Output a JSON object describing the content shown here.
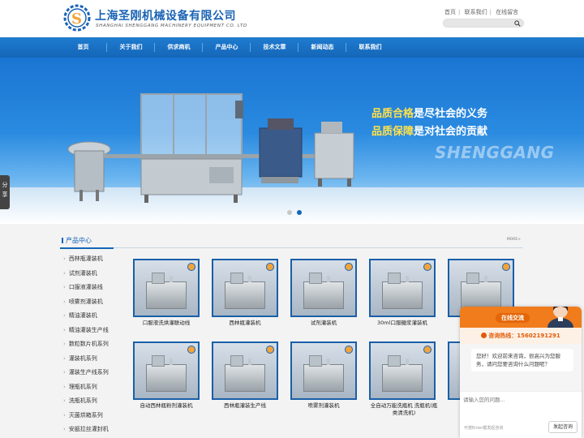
{
  "header": {
    "company_cn": "上海圣刚机械设备有限公司",
    "company_en": "SHANGHAI SHENGGANG MACHINERY EQUIPMENT CO. LTD",
    "links": [
      "首页",
      "联系我们",
      "在线留言"
    ],
    "search_placeholder": ""
  },
  "nav": [
    "首页",
    "关于我们",
    "供求商机",
    "产品中心",
    "技术文章",
    "新闻动态",
    "联系我们"
  ],
  "banner": {
    "slogan1_hl": "品质合格",
    "slogan1_rest": "是尽社会的义务",
    "slogan2_hl": "品质保障",
    "slogan2_rest": "是对社会的贡献",
    "watermark": "SHENGGANG",
    "slides": 2,
    "active_slide": 2
  },
  "share_label": "分享",
  "products": {
    "section_title": "产品中心",
    "more": "MORE>",
    "categories": [
      "西林瓶灌装机",
      "试剂灌装机",
      "口服液灌装线",
      "喷雾剂灌装机",
      "精油灌装机",
      "精油灌装生产线",
      "数粒数片机系列",
      "灌装机系列",
      "灌装生产线系列",
      "理瓶机系列",
      "洗瓶机系列",
      "灭菌烘箱系列",
      "安瓿拉丝灌封机"
    ],
    "items": [
      {
        "caption": "口服液洗烘灌联动线"
      },
      {
        "caption": "西林瓶灌装机"
      },
      {
        "caption": "试剂灌装机"
      },
      {
        "caption": "30ml口服糖浆灌装机"
      },
      {
        "caption": ""
      },
      {
        "caption": "自动西林瓶粉剂灌装机"
      },
      {
        "caption": "西林瓶灌装生产线"
      },
      {
        "caption": "喷雾剂灌装机"
      },
      {
        "caption": "全自动万能洗瓶机 洗瓶机(瓶类清洗机)"
      },
      {
        "caption": ""
      }
    ]
  },
  "chat": {
    "title": "在线交流",
    "hotline": "咨询热线：15602191291",
    "greeting": "您好！欢迎前来咨询，很高兴为您服务，请问您要咨询什么问题呢？",
    "input_placeholder": "请输入您的问题...",
    "hint": "可按Enter键发起咨询",
    "send": "发起咨询"
  },
  "colors": {
    "brand_blue": "#1466b8",
    "chat_orange": "#f07c1c"
  }
}
